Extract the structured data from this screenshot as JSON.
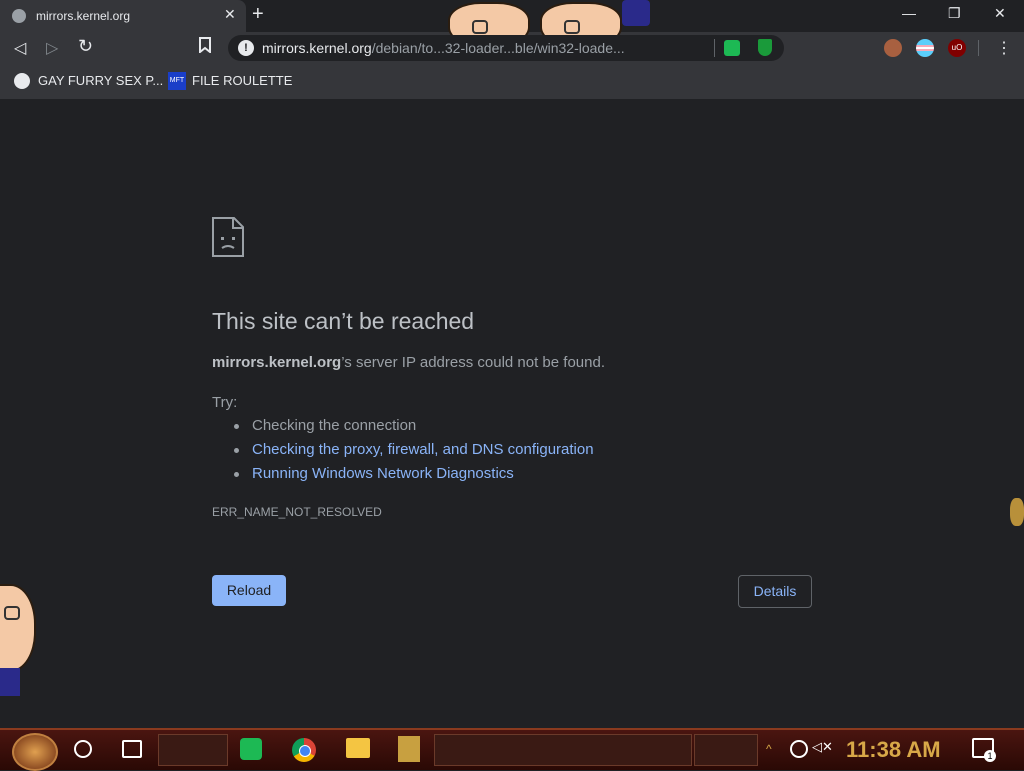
{
  "window": {
    "tab_title": "mirrors.kernel.org",
    "tab_close": "✕",
    "new_tab": "+",
    "minimize": "—",
    "restore": "❐",
    "close": "✕"
  },
  "toolbar": {
    "back": "◁",
    "forward": "▷",
    "reload": "↻",
    "bookmark": "🔖",
    "menu": "⋮",
    "url_host": "mirrors.kernel.org",
    "url_path": "/debian/to...32-loader...ble/win32-loade..."
  },
  "bookmarks": [
    {
      "label": "GAY FURRY SEX P...",
      "icon": "globe-icon"
    },
    {
      "label": "FILE ROULETTE",
      "icon": "mft-icon",
      "icon_text": "MFT"
    }
  ],
  "error_page": {
    "heading": "This site can’t be reached",
    "host": "mirrors.kernel.org",
    "description_suffix": "’s server IP address could not be found.",
    "try_label": "Try:",
    "suggestions": [
      "Checking the connection",
      "Checking the proxy, firewall, and DNS configuration",
      "Running Windows Network Diagnostics"
    ],
    "error_code": "ERR_NAME_NOT_RESOLVED",
    "reload_label": "Reload",
    "details_label": "Details"
  },
  "taskbar": {
    "clock": "11:38 AM",
    "notification_count": "1"
  },
  "colors": {
    "background": "#202124",
    "link": "#8ab4f8",
    "button": "#8ab4f8",
    "clock": "#d8a848"
  }
}
